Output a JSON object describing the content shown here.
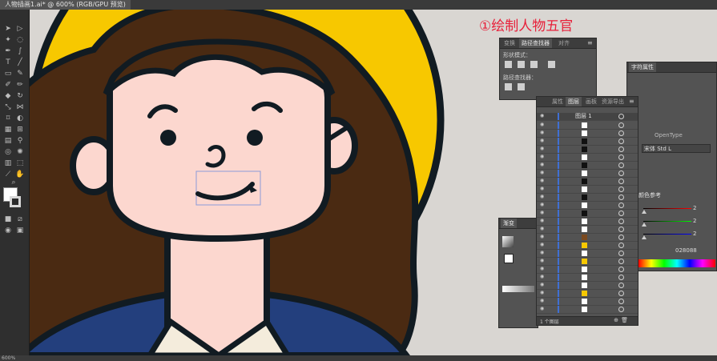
{
  "window": {
    "tab_title": "人物插画1.ai* @ 600% (RGB/GPU 预览)"
  },
  "canvas": {
    "title": "①绘制人物五官",
    "title_color": "#e8203a"
  },
  "colors": {
    "halo": "#f7c800",
    "hair": "#4a2a12",
    "skin": "#fcd7cf",
    "outline": "#111b22",
    "jacket": "#233f7d",
    "shirt": "#f4ecdc",
    "layer_highlight": "#3f6fd4"
  },
  "status": {
    "zoom": "600%"
  },
  "panels": {
    "pathfinder": {
      "tabs": [
        "变换",
        "路径查找器",
        "对齐"
      ],
      "active_tab": "路径查找器",
      "shape_modes_label": "形状模式：",
      "pathfinders_label": "路径查找器："
    },
    "layers": {
      "tabs": [
        "属性",
        "图层",
        "画板",
        "资源导出"
      ],
      "active_tab": "图层",
      "top_layer_name": "图层 1",
      "footer_label": "1 个图层"
    },
    "character": {
      "tab": "字符属性",
      "opentype_label": "OpenType",
      "font_label": "宋体 Std L",
      "color_label": "颜色参考",
      "values": [
        "2",
        "2",
        "2"
      ],
      "hex": "028088"
    },
    "gradient": {
      "tab": "渐变"
    }
  },
  "toolbar": {
    "icons": [
      "selection-icon",
      "direct-selection-icon",
      "magic-wand-icon",
      "lasso-icon",
      "pen-icon",
      "curvature-icon",
      "type-icon",
      "line-icon",
      "rectangle-icon",
      "paintbrush-icon",
      "shaper-icon",
      "pencil-icon",
      "eraser-icon",
      "rotate-icon",
      "scale-icon",
      "width-icon",
      "free-transform-icon",
      "shape-builder-icon",
      "perspective-icon",
      "mesh-icon",
      "gradient-icon",
      "eyedropper-icon",
      "blend-icon",
      "symbol-sprayer-icon",
      "column-graph-icon",
      "artboard-icon",
      "slice-icon",
      "hand-icon",
      "zoom-icon"
    ]
  }
}
